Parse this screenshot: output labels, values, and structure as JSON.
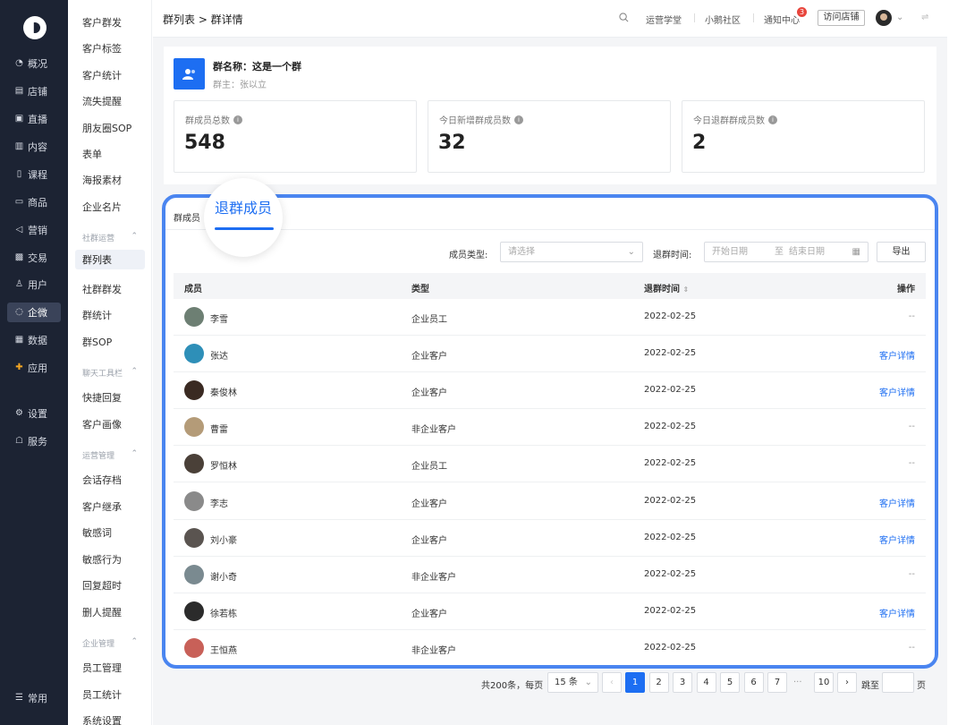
{
  "nav": {
    "items": [
      {
        "label": "概况",
        "icon": "clock-icon"
      },
      {
        "label": "店铺",
        "icon": "store-icon"
      },
      {
        "label": "直播",
        "icon": "live-icon"
      },
      {
        "label": "内容",
        "icon": "document-icon"
      },
      {
        "label": "课程",
        "icon": "book-icon"
      },
      {
        "label": "商品",
        "icon": "box-icon"
      },
      {
        "label": "营销",
        "icon": "megaphone-icon"
      },
      {
        "label": "交易",
        "icon": "trade-icon"
      },
      {
        "label": "用户",
        "icon": "user-icon"
      },
      {
        "label": "企微",
        "icon": "chat-icon",
        "active": true
      },
      {
        "label": "数据",
        "icon": "chart-icon"
      },
      {
        "label": "应用",
        "icon": "apps-icon"
      },
      {
        "label": "设置",
        "icon": "gear-icon"
      },
      {
        "label": "服务",
        "icon": "service-icon"
      }
    ],
    "bottom": {
      "label": "常用",
      "icon": "menu-icon"
    }
  },
  "submenu": {
    "top_items": [
      "客户群发",
      "客户标签",
      "客户统计",
      "流失提醒",
      "朋友圈SOP",
      "表单",
      "海报素材",
      "企业名片"
    ],
    "groups": [
      {
        "title": "社群运营",
        "items": [
          "群列表",
          "社群群发",
          "群统计",
          "群SOP"
        ]
      },
      {
        "title": "聊天工具栏",
        "items": [
          "快捷回复",
          "客户画像"
        ]
      },
      {
        "title": "运营管理",
        "items": [
          "会话存档",
          "客户继承",
          "敏感词",
          "敏感行为",
          "回复超时",
          "删人提醒"
        ]
      },
      {
        "title": "企业管理",
        "items": [
          "员工管理",
          "员工统计",
          "系统设置"
        ]
      }
    ],
    "active": "群列表"
  },
  "topbar": {
    "breadcrumb": "群列表 > 群详情",
    "links": [
      "运营学堂",
      "小鹅社区",
      "通知中心"
    ],
    "notification_count": "3",
    "visit_store": "访问店铺"
  },
  "group": {
    "name": "群名称：这是一个群",
    "owner": "群主：张以立"
  },
  "stats": [
    {
      "label": "群成员总数",
      "value": "548"
    },
    {
      "label": "今日新增群成员数",
      "value": "32"
    },
    {
      "label": "今日退群群成员数",
      "value": "2"
    }
  ],
  "members": {
    "tab_small": "群成员",
    "tab_active": "退群成员",
    "filter_type_label": "成员类型:",
    "filter_type_placeholder": "请选择",
    "filter_time_label": "退群时间:",
    "start_placeholder": "开始日期",
    "to": "至",
    "end_placeholder": "结束日期",
    "export": "导出",
    "columns": [
      "成员",
      "类型",
      "退群时间",
      "操作"
    ],
    "rows": [
      {
        "name": "李雪",
        "type": "企业员工",
        "date": "2022-02-25",
        "op": "--",
        "avatar_color": "#6d7f73"
      },
      {
        "name": "张达",
        "type": "企业客户",
        "date": "2022-02-25",
        "op": "客户详情",
        "avatar_color": "#2e8fb8"
      },
      {
        "name": "秦俊林",
        "type": "企业客户",
        "date": "2022-02-25",
        "op": "客户详情",
        "avatar_color": "#3a2a22"
      },
      {
        "name": "曹雷",
        "type": "非企业客户",
        "date": "2022-02-25",
        "op": "--",
        "avatar_color": "#b49b78"
      },
      {
        "name": "罗恒林",
        "type": "企业员工",
        "date": "2022-02-25",
        "op": "--",
        "avatar_color": "#4a4038"
      },
      {
        "name": "李志",
        "type": "企业客户",
        "date": "2022-02-25",
        "op": "客户详情",
        "avatar_color": "#8a8a8a"
      },
      {
        "name": "刘小豪",
        "type": "企业客户",
        "date": "2022-02-25",
        "op": "客户详情",
        "avatar_color": "#5a5450"
      },
      {
        "name": "谢小奇",
        "type": "非企业客户",
        "date": "2022-02-25",
        "op": "--",
        "avatar_color": "#7a8a90"
      },
      {
        "name": "徐若栋",
        "type": "企业客户",
        "date": "2022-02-25",
        "op": "客户详情",
        "avatar_color": "#2b2b2b"
      },
      {
        "name": "王恒燕",
        "type": "非企业客户",
        "date": "2022-02-25",
        "op": "--",
        "avatar_color": "#c86058"
      }
    ]
  },
  "pagination": {
    "total_text": "共200条，每页",
    "page_size": "15 条",
    "pages": [
      "1",
      "2",
      "3",
      "4",
      "5",
      "6",
      "7"
    ],
    "ellipsis": "···",
    "last_page": "10",
    "jump_label": "跳至",
    "page_unit": "页",
    "current": "1"
  },
  "colors": {
    "accent": "#1d6ef2",
    "nav_bg": "#1c2333",
    "highlight_border": "#4a85f0"
  }
}
